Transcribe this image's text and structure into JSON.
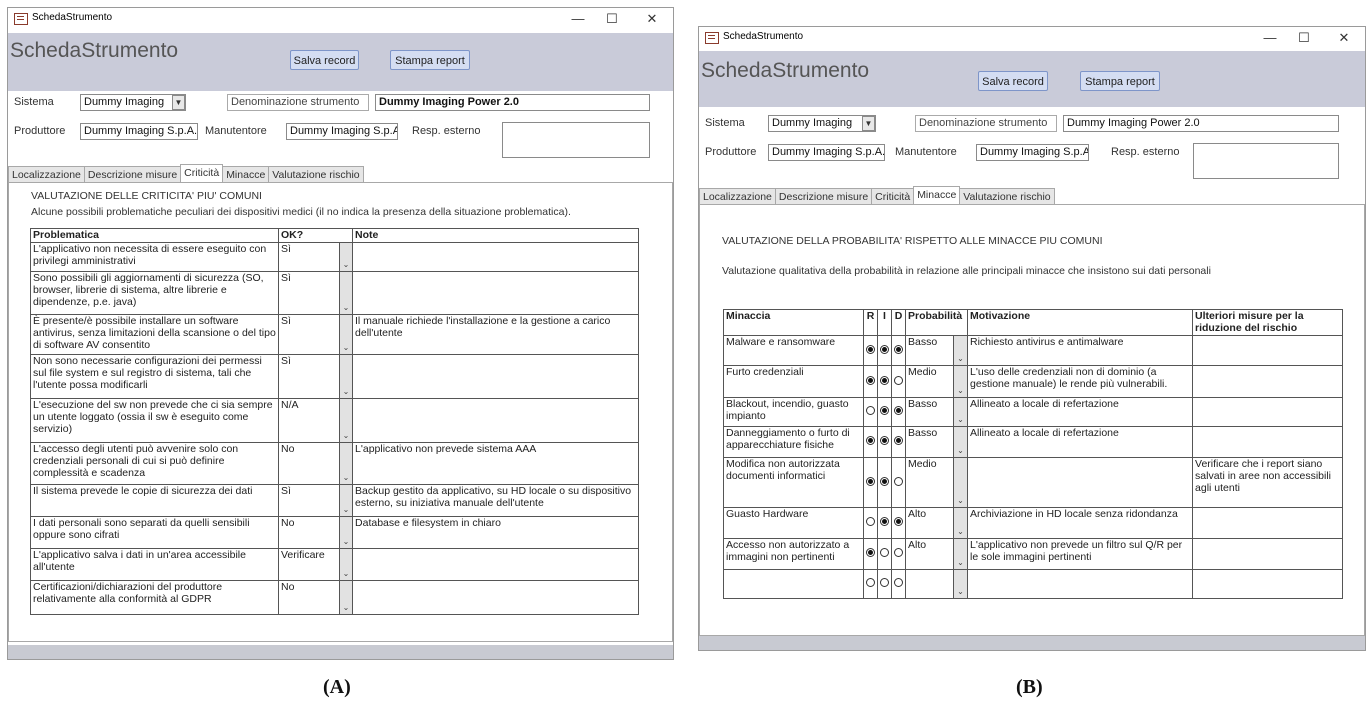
{
  "caption_a": "(A)",
  "caption_b": "(B)",
  "window_a": {
    "title": "SchedaStrumento",
    "form_title": "SchedaStrumento",
    "save_button": "Salva record",
    "print_button": "Stampa report",
    "sistema_label": "Sistema",
    "sistema_value": "Dummy Imaging",
    "denominazione_label": "Denominazione strumento",
    "denominazione_value": "Dummy Imaging  Power 2.0",
    "produttore_label": "Produttore",
    "produttore_value": "Dummy Imaging S.p.A.",
    "manutentore_label": "Manutentore",
    "manutentore_value": "Dummy Imaging S.p.A.",
    "resp_label": "Resp. esterno",
    "resp_value": "",
    "tabs": [
      "Localizzazione",
      "Descrizione misure",
      "Criticità",
      "Minacce",
      "Valutazione rischio"
    ],
    "active_tab": "Criticità",
    "section_title": "VALUTAZIONE DELLE CRITICITA' PIU' COMUNI",
    "section_subtitle": "Alcune possibili problematiche peculiari dei dispositivi medici (il no indica la presenza della situazione problematica).",
    "columns": [
      "Problematica",
      "OK?",
      "Note"
    ],
    "rows": [
      {
        "problematica": "L'applicativo non necessita di essere eseguito con privilegi amministrativi",
        "ok": "Sì",
        "note": ""
      },
      {
        "problematica": "Sono possibili gli aggiornamenti di sicurezza (SO, browser, librerie di sistema, altre librerie e dipendenze, p.e. java)",
        "ok": "Sì",
        "note": ""
      },
      {
        "problematica": "È presente/è possibile installare un software antivirus, senza limitazioni della scansione o del tipo di software AV consentito",
        "ok": "Sì",
        "note": "Il manuale richiede l'installazione e la gestione a carico dell'utente"
      },
      {
        "problematica": "Non sono necessarie configurazioni dei permessi sul file system e sul registro di sistema, tali che l'utente possa modificarli",
        "ok": "Sì",
        "note": ""
      },
      {
        "problematica": "L'esecuzione del sw non prevede che ci sia sempre un utente loggato (ossia il sw è eseguito come servizio)",
        "ok": "N/A",
        "note": ""
      },
      {
        "problematica": "L'accesso degli utenti può avvenire solo con credenziali personali di cui si può definire complessità e scadenza",
        "ok": "No",
        "note": "L'applicativo non prevede sistema AAA"
      },
      {
        "problematica": "Il sistema prevede le copie di sicurezza dei dati",
        "ok": "Sì",
        "note": "Backup gestito da applicativo, su HD locale o su dispositivo esterno, su iniziativa manuale dell'utente"
      },
      {
        "problematica": "I dati personali sono separati da quelli sensibili oppure sono cifrati",
        "ok": "No",
        "note": "Database e filesystem in chiaro"
      },
      {
        "problematica": "L'applicativo salva i dati in un'area accessibile all'utente",
        "ok": "Verificare",
        "note": ""
      },
      {
        "problematica": "Certificazioni/dichiarazioni del produttore relativamente alla conformità al GDPR",
        "ok": "No",
        "note": ""
      }
    ]
  },
  "window_b": {
    "title": "SchedaStrumento",
    "form_title": "SchedaStrumento",
    "save_button": "Salva record",
    "print_button": "Stampa report",
    "sistema_label": "Sistema",
    "sistema_value": "Dummy Imaging",
    "denominazione_label": "Denominazione strumento",
    "denominazione_value": "Dummy Imaging  Power 2.0",
    "produttore_label": "Produttore",
    "produttore_value": "Dummy Imaging S.p.A.",
    "manutentore_label": "Manutentore",
    "manutentore_value": "Dummy Imaging S.p.A.",
    "resp_label": "Resp. esterno",
    "resp_value": "",
    "tabs": [
      "Localizzazione",
      "Descrizione misure",
      "Criticità",
      "Minacce",
      "Valutazione rischio"
    ],
    "active_tab": "Minacce",
    "section_title": "VALUTAZIONE DELLA PROBABILITA' RISPETTO ALLE MINACCE PIU COMUNI",
    "section_subtitle": "Valutazione qualitativa della probabilità in relazione alle principali minacce che insistono sui dati personali",
    "columns": [
      "Minaccia",
      "R",
      "I",
      "D",
      "Probabilità",
      "Motivazione",
      "Ulteriori misure per la riduzione del rischio"
    ],
    "rows": [
      {
        "minaccia": "Malware e ransomware",
        "r": true,
        "i": true,
        "d": true,
        "prob": "Basso",
        "motivazione": "Richiesto antivirus e antimalware",
        "misure": ""
      },
      {
        "minaccia": "Furto credenziali",
        "r": true,
        "i": true,
        "d": false,
        "prob": "Medio",
        "motivazione": "L'uso delle credenziali non di dominio (a gestione manuale) le rende più vulnerabili.",
        "misure": ""
      },
      {
        "minaccia": "Blackout, incendio, guasto impianto",
        "r": false,
        "i": true,
        "d": true,
        "prob": "Basso",
        "motivazione": "Allineato a locale di refertazione",
        "misure": ""
      },
      {
        "minaccia": "Danneggiamento o furto di apparecchiature fisiche",
        "r": true,
        "i": true,
        "d": true,
        "prob": "Basso",
        "motivazione": "Allineato a locale di refertazione",
        "misure": ""
      },
      {
        "minaccia": "Modifica non autorizzata documenti informatici",
        "r": true,
        "i": true,
        "d": false,
        "prob": "Medio",
        "motivazione": "",
        "misure": "Verificare che i report siano salvati  in aree non accessibili  agli utenti"
      },
      {
        "minaccia": "Guasto Hardware",
        "r": false,
        "i": true,
        "d": true,
        "prob": "Alto",
        "motivazione": "Archiviazione in HD locale senza ridondanza",
        "misure": ""
      },
      {
        "minaccia": "Accesso non autorizzato a immagini non pertinenti",
        "r": true,
        "i": false,
        "d": false,
        "prob": "Alto",
        "motivazione": "L'applicativo non prevede un filtro sul Q/R per le sole immagini pertinenti",
        "misure": ""
      },
      {
        "minaccia": "",
        "r": false,
        "i": false,
        "d": false,
        "prob": "",
        "motivazione": "",
        "misure": ""
      }
    ]
  }
}
